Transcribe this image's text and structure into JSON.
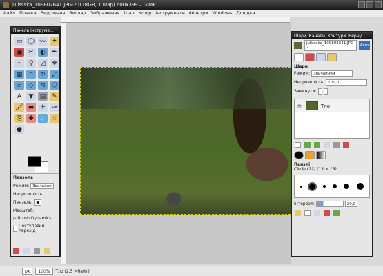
{
  "window": {
    "title": "julissska_109802641.JPG-2.0 (RGB, 1 шар) 600x399 – GIMP"
  },
  "menu": [
    "Файл",
    "Правка",
    "Виділення",
    "Вигляд",
    "Зображення",
    "Шар",
    "Колір",
    "Інструменти",
    "Фільтри",
    "Windows",
    "Довідка"
  ],
  "toolbox": {
    "title": "Панель інструме...",
    "tools": [
      {
        "name": "rect-select-icon",
        "color": "#cfd6e6",
        "glyph": "▭"
      },
      {
        "name": "ellipse-select-icon",
        "color": "#cfd6e6",
        "glyph": "◯"
      },
      {
        "name": "lasso-icon",
        "color": "#cfd6e6",
        "glyph": "〰"
      },
      {
        "name": "fuzzy-select-icon",
        "color": "#e5c86f",
        "glyph": "✦"
      },
      {
        "name": "select-by-color-icon",
        "color": "#d04b4b",
        "glyph": "▣"
      },
      {
        "name": "scissors-icon",
        "color": "#cfd6e6",
        "glyph": "✂"
      },
      {
        "name": "foreground-select-icon",
        "color": "#6aa6d6",
        "glyph": "◐"
      },
      {
        "name": "paths-icon",
        "color": "#cfd6e6",
        "glyph": "✒"
      },
      {
        "name": "color-picker-icon",
        "color": "#cfd6e6",
        "glyph": "⌁"
      },
      {
        "name": "zoom-icon",
        "color": "#cfd6e6",
        "glyph": "⚲"
      },
      {
        "name": "measure-icon",
        "color": "#cfd6e6",
        "glyph": "◿"
      },
      {
        "name": "move-icon",
        "color": "#cfd6e6",
        "glyph": "✥"
      },
      {
        "name": "align-icon",
        "color": "#6aa6d6",
        "glyph": "▦"
      },
      {
        "name": "crop-icon",
        "color": "#6aa6d6",
        "glyph": "⌗"
      },
      {
        "name": "rotate-icon",
        "color": "#6aa6d6",
        "glyph": "↻"
      },
      {
        "name": "scale-icon",
        "color": "#6aa6d6",
        "glyph": "⤢"
      },
      {
        "name": "shear-icon",
        "color": "#6aa6d6",
        "glyph": "▱"
      },
      {
        "name": "perspective-icon",
        "color": "#6aa6d6",
        "glyph": "◇"
      },
      {
        "name": "flip-icon",
        "color": "#6aa6d6",
        "glyph": "⇆"
      },
      {
        "name": "cage-icon",
        "color": "#6aa6d6",
        "glyph": "⬡"
      },
      {
        "name": "text-icon",
        "color": "#e6e6e6",
        "glyph": "A"
      },
      {
        "name": "bucket-fill-icon",
        "color": "#cfd6e6",
        "glyph": "▼"
      },
      {
        "name": "blend-icon",
        "color": "#9aa0aa",
        "glyph": "▤"
      },
      {
        "name": "pencil-icon",
        "color": "#e5c86f",
        "glyph": "✎"
      },
      {
        "name": "paintbrush-icon",
        "color": "#e5c86f",
        "glyph": "🖌"
      },
      {
        "name": "eraser-icon",
        "color": "#e88a8a",
        "glyph": "▬"
      },
      {
        "name": "airbrush-icon",
        "color": "#cfd6e6",
        "glyph": "✈"
      },
      {
        "name": "ink-icon",
        "color": "#cfd6e6",
        "glyph": "✑"
      },
      {
        "name": "clone-icon",
        "color": "#e5c86f",
        "glyph": "⎘"
      },
      {
        "name": "heal-icon",
        "color": "#e88a8a",
        "glyph": "✚"
      },
      {
        "name": "blur-icon",
        "color": "#6aa6d6",
        "glyph": "💧"
      },
      {
        "name": "smudge-icon",
        "color": "#e5c86f",
        "glyph": "☝"
      },
      {
        "name": "dodge-burn-icon",
        "color": "#cfd6e6",
        "glyph": "●"
      }
    ],
    "options": {
      "header": "Пензель",
      "mode_label": "Режим:",
      "mode_value": "Звичайни",
      "opacity_label": "Непрозорість:",
      "brush_label": "Пензель:",
      "scale_label": "Масштаб:",
      "dynamics_label": "Brush Dynamics",
      "fade_label": "Поступовий перехід"
    }
  },
  "layers_panel": {
    "title": "Шари, Канали, Контури, Верну...",
    "image_name": "julissska_109802641.JPG-2",
    "auto_label": "Авто",
    "layers_header": "Шари",
    "mode_label": "Режим:",
    "mode_value": "Звичайний",
    "opacity_label": "Непрозорість:",
    "opacity_value": "100,0",
    "lock_label": "Замкнути:",
    "layer_name": "Тло",
    "brushes_header": "Пензлі",
    "brush_name": "Circle (11) (13 × 13)",
    "spacing_label": "Інтервал:",
    "spacing_value": "20,0"
  },
  "statusbar": {
    "unit": "px",
    "zoom": "100%",
    "info": "Тло (2,5 Мбайт)"
  }
}
